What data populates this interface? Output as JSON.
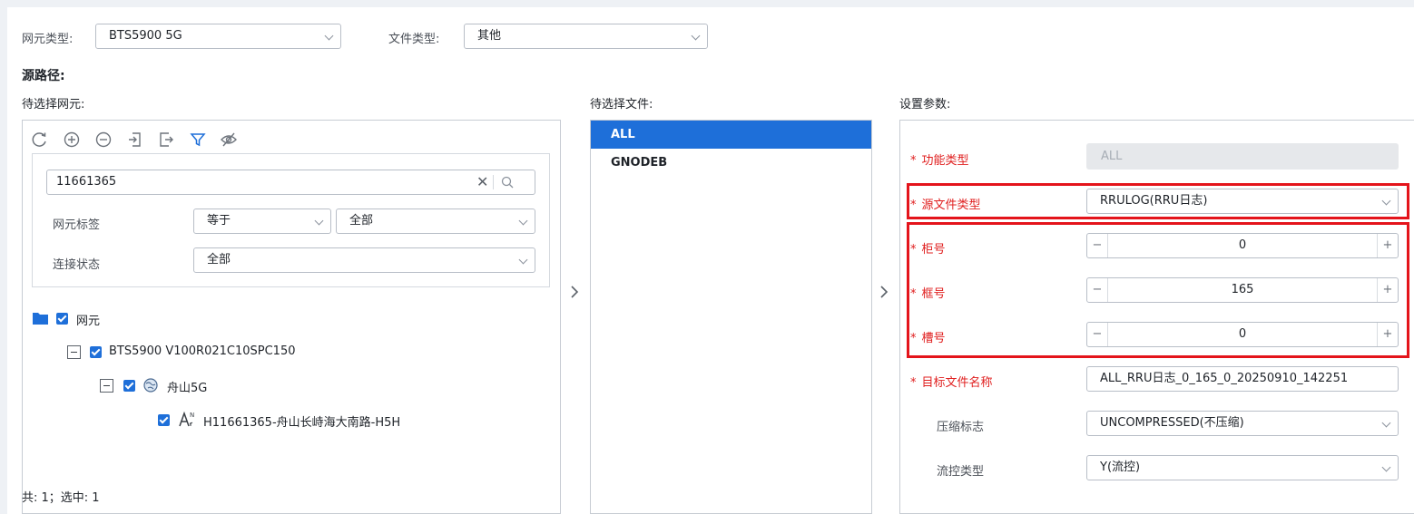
{
  "filters": {
    "ne_type_label": "网元类型:",
    "ne_type_value": "BTS5900 5G",
    "file_type_label": "文件类型:",
    "file_type_value": "其他"
  },
  "source_path_label": "源路径:",
  "left": {
    "title": "待选择网元:",
    "search_value": "11661365",
    "tag_label": "网元标签",
    "tag_op": "等于",
    "tag_value": "全部",
    "conn_label": "连接状态",
    "conn_value": "全部",
    "tree": {
      "root": "网元",
      "version": "BTS5900 V100R021C10SPC150",
      "group": "舟山5G",
      "node": "H11661365-舟山长峙海大南路-H5H"
    },
    "footer": "共: 1；选中: 1"
  },
  "middle": {
    "title": "待选择文件:",
    "items": [
      "ALL",
      "GNODEB"
    ]
  },
  "right": {
    "title": "设置参数:",
    "func_type_label": "功能类型",
    "func_type_value": "ALL",
    "src_file_type_label": "源文件类型",
    "src_file_type_value": "RRULOG(RRU日志)",
    "cabinet_label": "柜号",
    "cabinet_value": "0",
    "frame_label": "框号",
    "frame_value": "165",
    "slot_label": "槽号",
    "slot_value": "0",
    "target_name_label": "目标文件名称",
    "target_name_value": "ALL_RRU日志_0_165_0_20250910_142251",
    "compress_label": "压缩标志",
    "compress_value": "UNCOMPRESSED(不压缩)",
    "flow_label": "流控类型",
    "flow_value": "Y(流控)"
  },
  "colors": {
    "accent": "#1e6fd9",
    "selected_bg": "#1e6fd9",
    "highlight_border": "#e4141b",
    "required_star": "#e02020"
  }
}
